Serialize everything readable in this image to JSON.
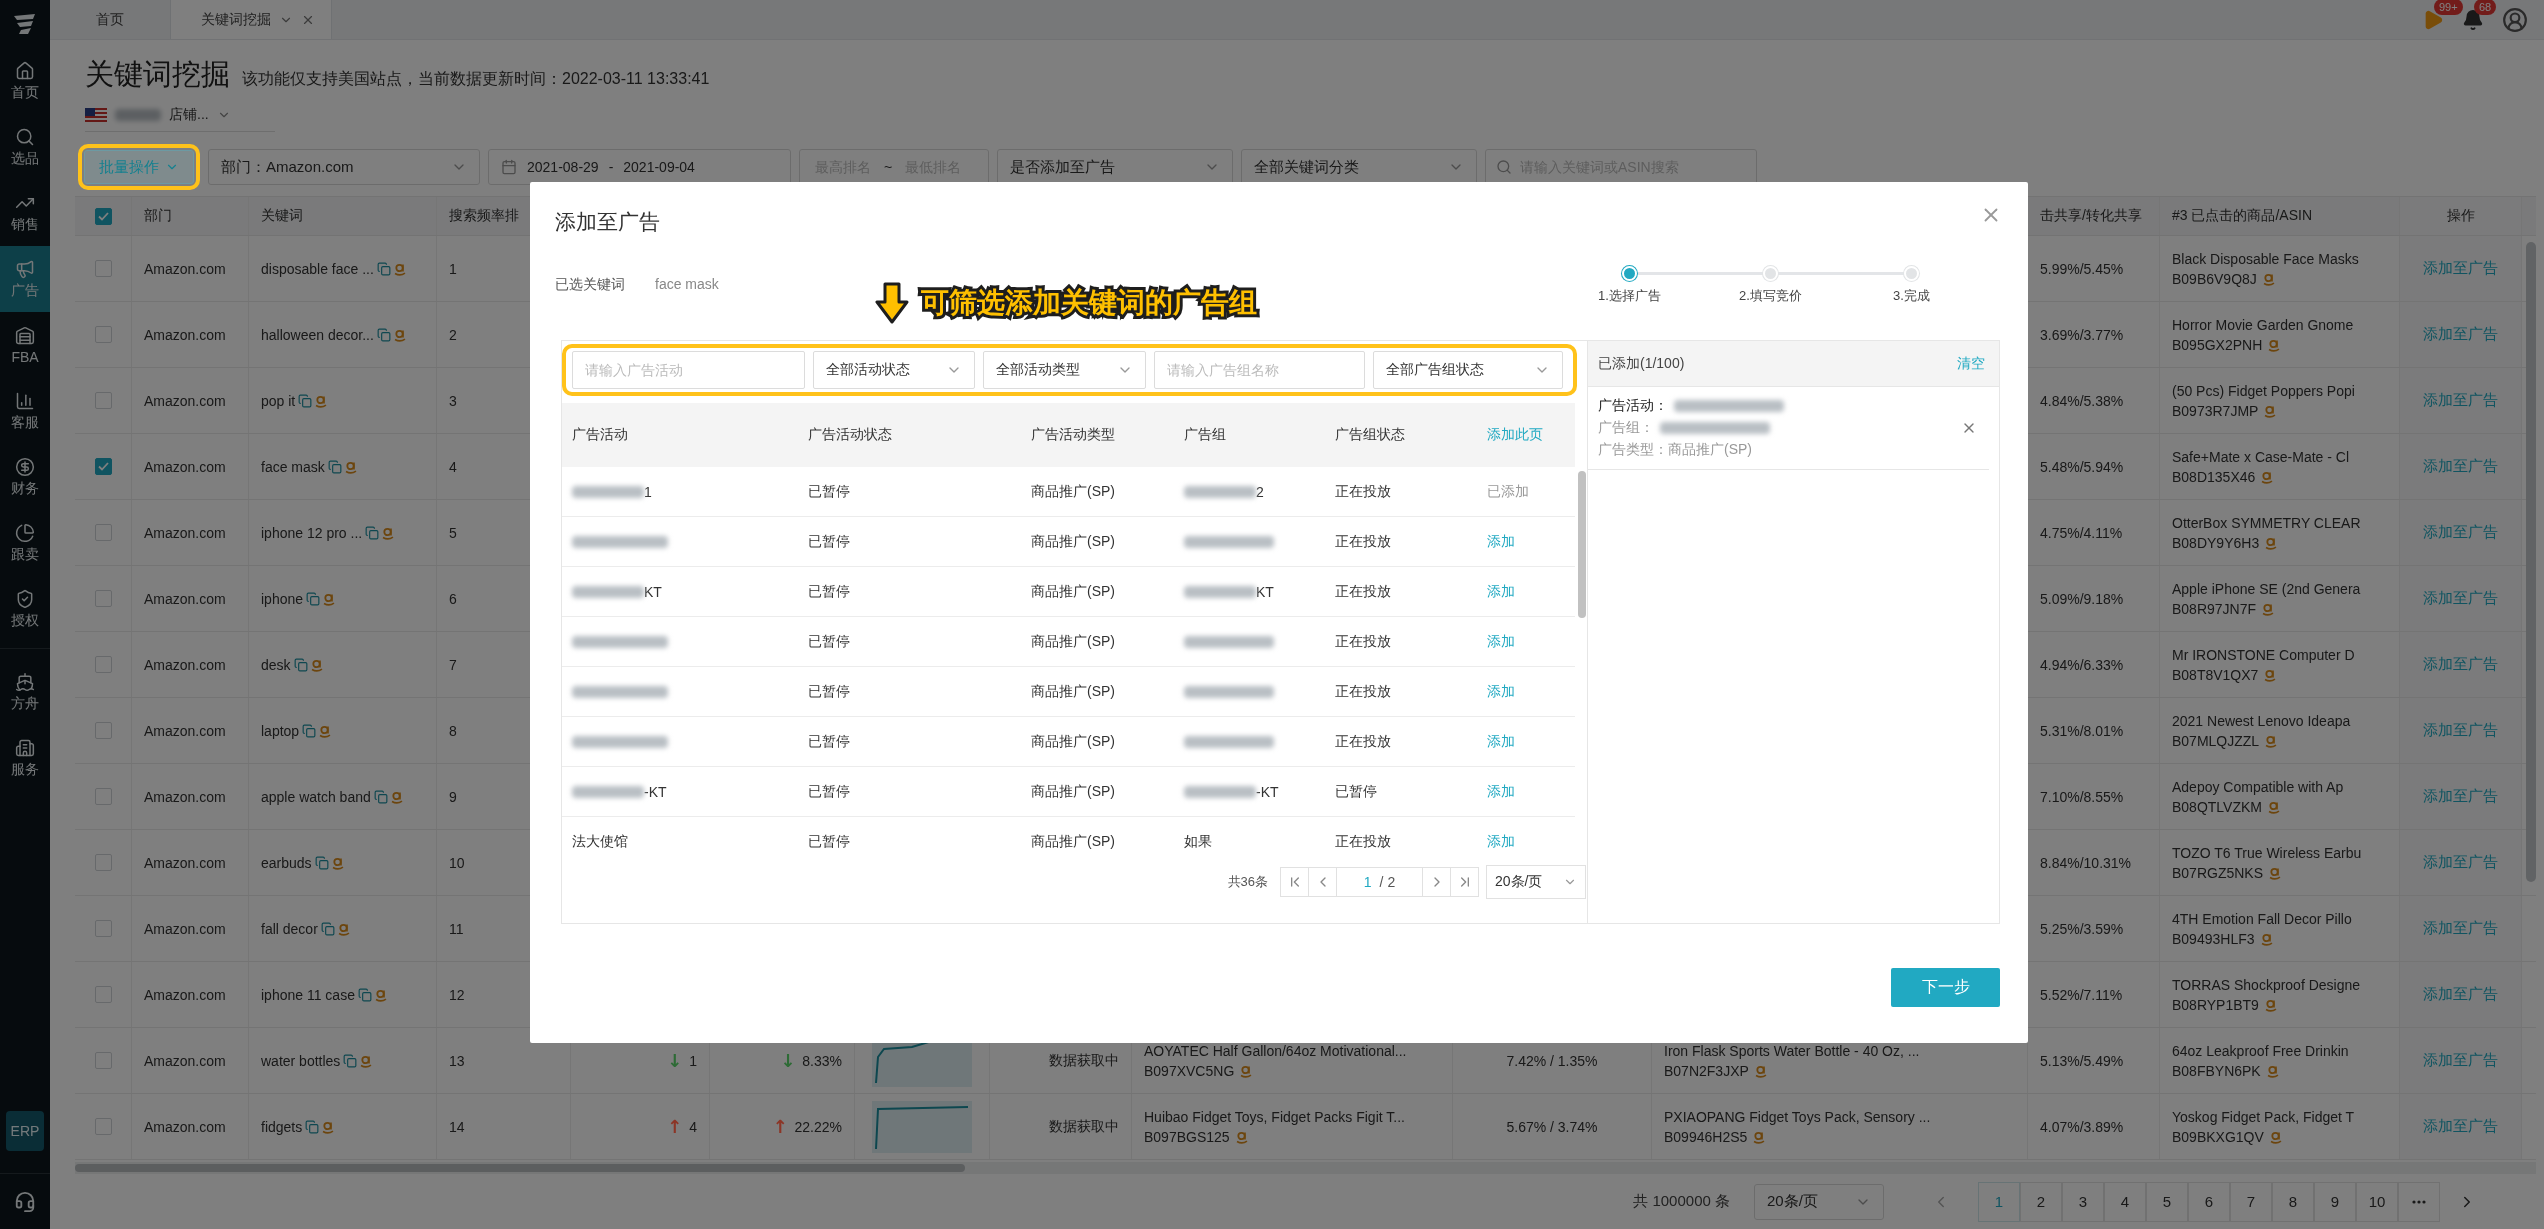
{
  "sidebar": {
    "groups": [
      {
        "items": [
          {
            "label": "首页",
            "selected": false
          },
          {
            "label": "选品",
            "selected": false
          },
          {
            "label": "销售",
            "selected": false
          },
          {
            "label": "广告",
            "selected": true
          },
          {
            "label": "FBA",
            "selected": false
          },
          {
            "label": "客服",
            "selected": false
          },
          {
            "label": "财务",
            "selected": false
          },
          {
            "label": "跟卖",
            "selected": false
          },
          {
            "label": "授权",
            "selected": false
          }
        ]
      },
      {
        "items": [
          {
            "label": "方舟",
            "selected": false
          },
          {
            "label": "服务",
            "selected": false
          }
        ]
      }
    ],
    "badge": "ERP"
  },
  "tabs": [
    {
      "label": "首页",
      "selected": false
    },
    {
      "label": "关键词挖掘",
      "selected": true
    }
  ],
  "notifications": [
    {
      "badge": "99+"
    },
    {
      "badge": "68"
    }
  ],
  "page": {
    "title": "关键词挖掘",
    "subtitle": "该功能仅支持美国站点，当前数据更新时间：2022-03-11 13:33:41",
    "store": "店铺..."
  },
  "filters": {
    "bulk_button": "批量操作",
    "department": "部门：Amazon.com",
    "date_start": "2021-08-29",
    "date_sep": "-",
    "date_end": "2021-09-04",
    "rank_high_placeholder": "最高排名",
    "rank_sep": "~",
    "rank_low_placeholder": "最低排名",
    "ad_status": "是否添加至广告",
    "category": "全部关键词分类",
    "search_placeholder": "请输入关键词或ASIN搜索"
  },
  "table": {
    "all_checked": true,
    "columns": {
      "department": "部门",
      "keyword": "关键词",
      "rank": "搜索频率排",
      "column_12": "击共享/转化共享",
      "product_3": "#3 已点击的商品/ASIN",
      "action": "操作"
    },
    "rows": [
      {
        "checked": false,
        "department": "Amazon.com",
        "keyword": "disposable face ...",
        "rank": "1",
        "share_3": "5.99%/5.45%",
        "product_3": "Black Disposable Face Masks",
        "asin_3": "B09B6V9Q8J",
        "action": "添加至广告"
      },
      {
        "checked": false,
        "department": "Amazon.com",
        "keyword": "halloween decor...",
        "rank": "2",
        "share_3": "3.69%/3.77%",
        "product_3": "Horror Movie Garden Gnome",
        "asin_3": "B095GX2PNH",
        "action": "添加至广告"
      },
      {
        "checked": false,
        "department": "Amazon.com",
        "keyword": "pop it",
        "rank": "3",
        "share_3": "4.84%/5.38%",
        "product_3": "(50 Pcs) Fidget Poppers Popi",
        "asin_3": "B0973R7JMP",
        "action": "添加至广告"
      },
      {
        "checked": true,
        "department": "Amazon.com",
        "keyword": "face mask",
        "rank": "4",
        "share_3": "5.48%/5.94%",
        "product_3": "Safe+Mate x Case-Mate - Cl",
        "asin_3": "B08D135X46",
        "action": "添加至广告"
      },
      {
        "checked": false,
        "department": "Amazon.com",
        "keyword": "iphone 12 pro ...",
        "rank": "5",
        "share_3": "4.75%/4.11%",
        "product_3": "OtterBox SYMMETRY CLEAR",
        "asin_3": "B08DY9Y6H3",
        "action": "添加至广告"
      },
      {
        "checked": false,
        "department": "Amazon.com",
        "keyword": "iphone",
        "rank": "6",
        "share_3": "5.09%/9.18%",
        "product_3": "Apple iPhone SE (2nd Genera",
        "asin_3": "B08R97JN7F",
        "action": "添加至广告"
      },
      {
        "checked": false,
        "department": "Amazon.com",
        "keyword": "desk",
        "rank": "7",
        "share_3": "4.94%/6.33%",
        "product_3": "Mr IRONSTONE Computer D",
        "asin_3": "B08T8V1QX7",
        "action": "添加至广告"
      },
      {
        "checked": false,
        "department": "Amazon.com",
        "keyword": "laptop",
        "rank": "8",
        "share_3": "5.31%/8.01%",
        "product_3": "2021 Newest Lenovo Ideapa",
        "asin_3": "B07MLQJZZL",
        "action": "添加至广告"
      },
      {
        "checked": false,
        "department": "Amazon.com",
        "keyword": "apple watch band",
        "rank": "9",
        "share_3": "7.10%/8.55%",
        "product_3": "Adepoy Compatible with Ap",
        "asin_3": "B08QTLVZKM",
        "action": "添加至广告"
      },
      {
        "checked": false,
        "department": "Amazon.com",
        "keyword": "earbuds",
        "rank": "10",
        "share_3": "8.84%/10.31%",
        "product_3": "TOZO T6 True Wireless Earbu",
        "asin_3": "B07RGZ5NKS",
        "action": "添加至广告"
      },
      {
        "checked": false,
        "department": "Amazon.com",
        "keyword": "fall decor",
        "rank": "11",
        "share_3": "5.25%/3.59%",
        "product_3": "4TH Emotion Fall Decor Pillo",
        "asin_3": "B09493HLF3",
        "action": "添加至广告"
      },
      {
        "checked": false,
        "department": "Amazon.com",
        "keyword": "iphone 11 case",
        "rank": "12",
        "share_3": "5.52%/7.11%",
        "product_3": "TORRAS Shockproof Designe",
        "asin_3": "B08RYP1BT9",
        "action": "添加至广告"
      },
      {
        "checked": false,
        "department": "Amazon.com",
        "keyword": "water bottles",
        "rank": "13",
        "rank_change": {
          "arrow": "↓",
          "value": "1",
          "color": "#2d6b35"
        },
        "pct_change": {
          "arrow": "↓",
          "value": "8.33%",
          "color": "#2d6b35"
        },
        "status": "数据获取中",
        "product_1": "AOYATEC Half Gallon/64oz Motivational...",
        "asin_1": "B097XVC5NG",
        "share_1": "7.42% / 1.35%",
        "product_2": "Iron Flask Sports Water Bottle - 40 Oz, ...",
        "asin_2": "B07N2F3JXP",
        "share_3": "5.13%/5.49%",
        "product_3": "64oz Leakproof Free Drinkin",
        "asin_3": "B08FBYN6PK",
        "action": "添加至广告"
      },
      {
        "checked": false,
        "department": "Amazon.com",
        "keyword": "fidgets",
        "rank": "14",
        "rank_change": {
          "arrow": "↑",
          "value": "4",
          "color": "#8c3526"
        },
        "pct_change": {
          "arrow": "↑",
          "value": "22.22%",
          "color": "#8c3526"
        },
        "status": "数据获取中",
        "product_1": "Huibao Fidget Toys, Fidget Packs Figit T...",
        "asin_1": "B097BGS125",
        "share_1": "5.67% / 3.74%",
        "product_2": "PXIAOPANG Fidget Toys Pack, Sensory ...",
        "asin_2": "B09946H2S5",
        "share_3": "4.07%/3.89%",
        "product_3": "Yoskog Fidget Pack, Fidget T",
        "asin_3": "B09BKXG1QV",
        "action": "添加至广告"
      }
    ]
  },
  "pagination": {
    "total": "共 1000000 条",
    "page_size": "20条/页",
    "pages": [
      {
        "label": "1",
        "selected": true
      },
      {
        "label": "2",
        "selected": false
      },
      {
        "label": "3",
        "selected": false
      },
      {
        "label": "4",
        "selected": false
      },
      {
        "label": "5",
        "selected": false
      },
      {
        "label": "6",
        "selected": false
      },
      {
        "label": "7",
        "selected": false
      },
      {
        "label": "8",
        "selected": false
      },
      {
        "label": "9",
        "selected": false
      },
      {
        "label": "10",
        "selected": false
      }
    ]
  },
  "modal": {
    "title": "添加至广告",
    "keyword_label": "已选关键词",
    "keyword": "face mask",
    "steps": [
      {
        "label": "1.选择广告",
        "selected": true
      },
      {
        "label": "2.填写竞价",
        "selected": false
      },
      {
        "label": "3.完成",
        "selected": false
      }
    ],
    "annotation": "可筛选添加关键词的广告组",
    "filters": {
      "campaign_placeholder": "请输入广告活动",
      "campaign_status": "全部活动状态",
      "campaign_type": "全部活动类型",
      "group_placeholder": "请输入广告组名称",
      "group_status": "全部广告组状态"
    },
    "columns": {
      "campaign": "广告活动",
      "campaign_status": "广告活动状态",
      "campaign_type": "广告活动类型",
      "group": "广告组",
      "group_status": "广告组状态",
      "add_page": "添加此页"
    },
    "rows": [
      {
        "campaign_blurred": true,
        "campaign": "1",
        "status": "已暂停",
        "type": "商品推广(SP)",
        "group_blurred": true,
        "group": "2",
        "group_status": "正在投放",
        "action": "已添加",
        "added": true
      },
      {
        "campaign_blurred": true,
        "status": "已暂停",
        "type": "商品推广(SP)",
        "group_blurred": true,
        "group_status": "正在投放",
        "action": "添加",
        "added": false
      },
      {
        "campaign_blurred": true,
        "campaign": "KT",
        "status": "已暂停",
        "type": "商品推广(SP)",
        "group_blurred": true,
        "group": "KT",
        "group_status": "正在投放",
        "action": "添加",
        "added": false
      },
      {
        "campaign_blurred": true,
        "status": "已暂停",
        "type": "商品推广(SP)",
        "group_blurred": true,
        "group_status": "正在投放",
        "action": "添加",
        "added": false
      },
      {
        "campaign_blurred": true,
        "status": "已暂停",
        "type": "商品推广(SP)",
        "group_blurred": true,
        "group_status": "正在投放",
        "action": "添加",
        "added": false
      },
      {
        "campaign_blurred": true,
        "status": "已暂停",
        "type": "商品推广(SP)",
        "group_blurred": true,
        "group_status": "正在投放",
        "action": "添加",
        "added": false
      },
      {
        "campaign_blurred": true,
        "campaign": "-KT",
        "status": "已暂停",
        "type": "商品推广(SP)",
        "group_blurred": true,
        "group": "-KT",
        "group_status": "已暂停",
        "action": "添加",
        "added": false
      },
      {
        "campaign_blurred": false,
        "campaign": "法大使馆",
        "status": "已暂停",
        "type": "商品推广(SP)",
        "group_blurred": false,
        "group": "如果",
        "group_status": "正在投放",
        "action": "添加",
        "added": false
      }
    ],
    "pagination": {
      "total": "共36条",
      "page": "1",
      "pages": "/ 2",
      "page_size": "20条/页"
    },
    "added_panel": {
      "title": "已添加(1/100)",
      "clear": "清空",
      "items": [
        {
          "campaign_label": "广告活动：",
          "group_label": "广告组：",
          "type": "广告类型：商品推广(SP)"
        }
      ]
    },
    "next_button": "下一步"
  }
}
